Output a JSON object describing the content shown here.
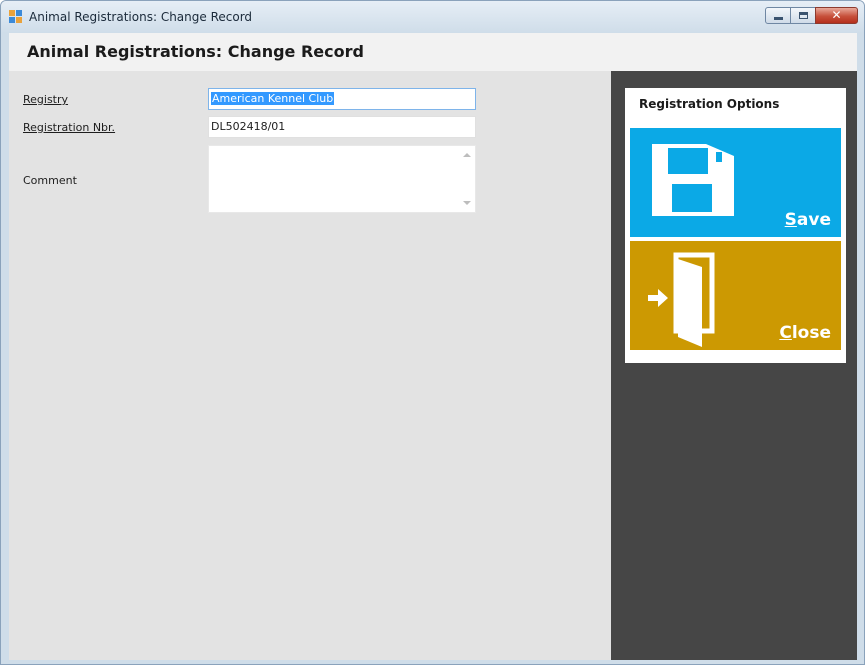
{
  "window": {
    "title": "Animal Registrations: Change Record"
  },
  "header": {
    "title": "Animal Registrations: Change Record"
  },
  "form": {
    "registry": {
      "label": "Registry",
      "value": "American Kennel Club"
    },
    "registration_nbr": {
      "label": "Registration Nbr.",
      "value": "DL502418/01"
    },
    "comment": {
      "label": "Comment",
      "value": ""
    }
  },
  "options": {
    "title": "Registration Options",
    "save": {
      "label_rest": "ave",
      "label_accel": "S",
      "icon": "floppy-disk-icon",
      "color": "#0ba9e6"
    },
    "close": {
      "label_rest": "lose",
      "label_accel": "C",
      "icon": "open-door-icon",
      "color": "#cc9902"
    }
  },
  "colors": {
    "panel_dark": "#464646",
    "form_bg": "#e3e3e3",
    "selection": "#3399ff"
  }
}
